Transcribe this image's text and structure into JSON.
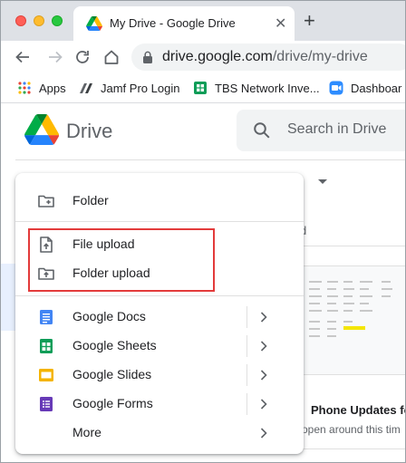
{
  "browser": {
    "tab_title": "My Drive - Google Drive",
    "tab_close": "✕",
    "new_tab": "+",
    "url_host": "drive.google.com",
    "url_path": "/drive/my-drive",
    "bookmarks": [
      {
        "label": "Apps",
        "icon": "apps-grid-icon"
      },
      {
        "label": "Jamf Pro Login",
        "icon": "jamf-icon"
      },
      {
        "label": "TBS Network Inve...",
        "icon": "sheets-icon"
      },
      {
        "label": "Dashboar",
        "icon": "zoom-icon"
      }
    ]
  },
  "drive": {
    "title": "Drive",
    "search_placeholder": "Search in Drive"
  },
  "background": {
    "mydrive_fragment": "e",
    "column_fragment": "d",
    "card_title": "Phone Updates fo",
    "card_subtitle": "open around this tim"
  },
  "menu": {
    "items": [
      {
        "label": "Folder",
        "icon": "new-folder-icon"
      },
      {
        "label": "File upload",
        "icon": "file-upload-icon"
      },
      {
        "label": "Folder upload",
        "icon": "folder-upload-icon"
      },
      {
        "label": "Google Docs",
        "icon": "google-docs-icon",
        "submenu": true
      },
      {
        "label": "Google Sheets",
        "icon": "google-sheets-icon",
        "submenu": true
      },
      {
        "label": "Google Slides",
        "icon": "google-slides-icon",
        "submenu": true
      },
      {
        "label": "Google Forms",
        "icon": "google-forms-icon",
        "submenu": true
      },
      {
        "label": "More",
        "icon": "",
        "submenu": true
      }
    ]
  },
  "colors": {
    "docs": "#4285f4",
    "sheets": "#0f9d58",
    "slides": "#f4b400",
    "forms": "#673ab7",
    "highlight": "#e33b3b"
  }
}
